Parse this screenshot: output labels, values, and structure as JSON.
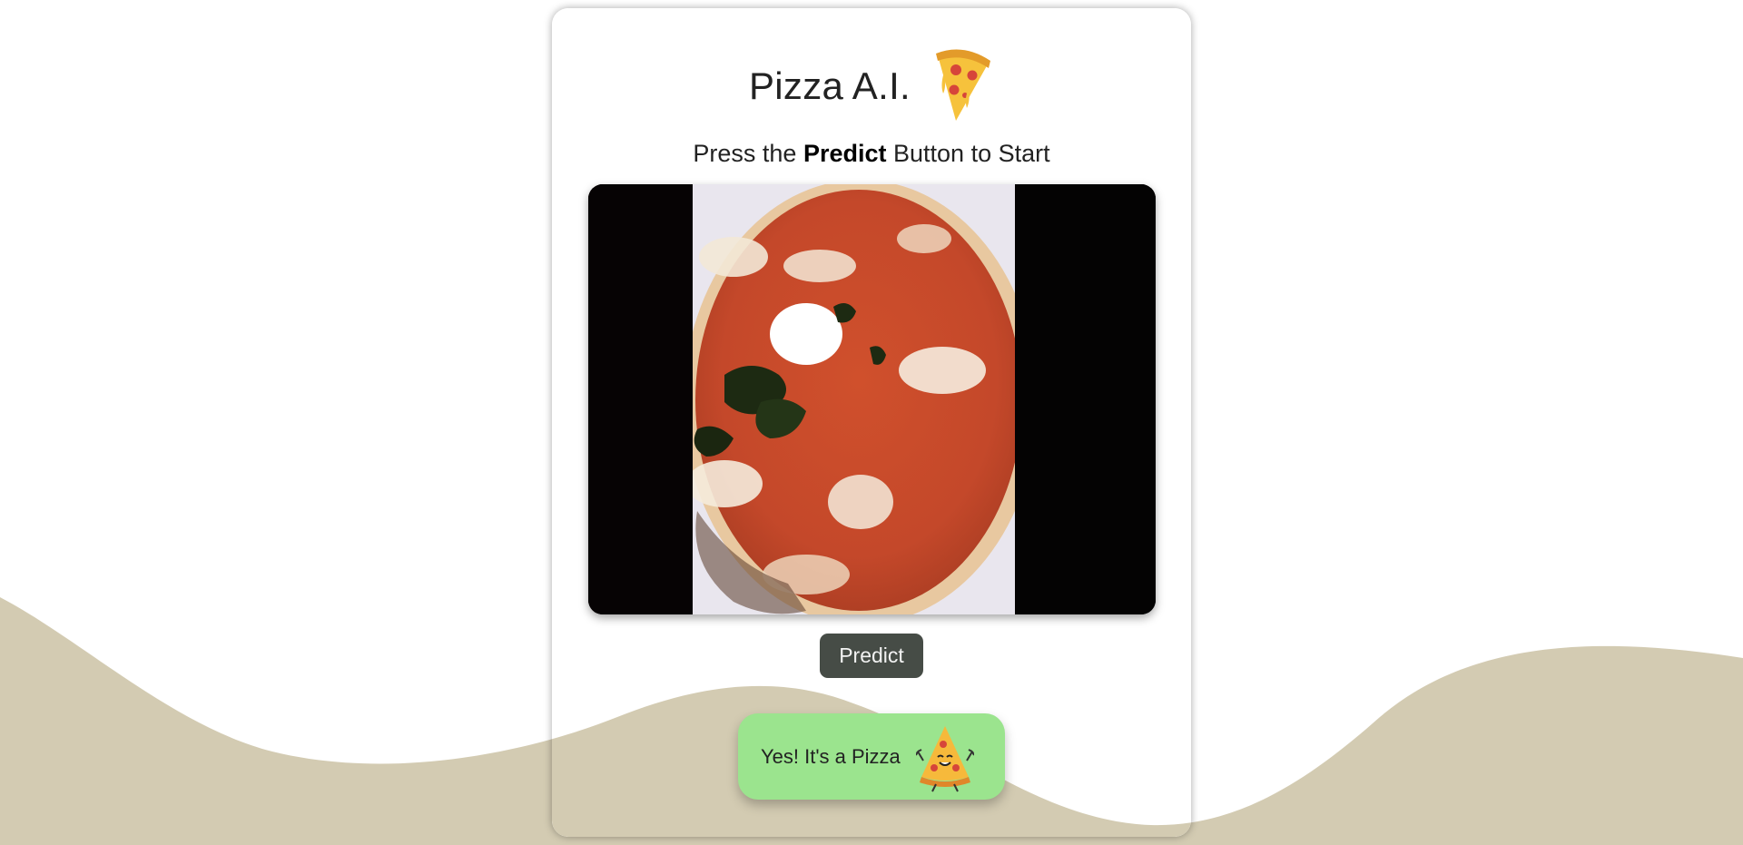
{
  "app": {
    "title": "Pizza A.I.",
    "logo_icon": "pizza-slice-icon"
  },
  "instructions": {
    "prefix": "Press the ",
    "emphasis": "Predict",
    "suffix": " Button to Start"
  },
  "camera": {
    "content": "live camera preview of a pizza"
  },
  "predict_button": {
    "label": "Predict"
  },
  "result": {
    "text": "Yes! It's a Pizza",
    "icon": "happy-pizza-icon",
    "color": "#9be48e"
  },
  "colors": {
    "wave": "#d3cbb2",
    "button": "#464c46"
  }
}
